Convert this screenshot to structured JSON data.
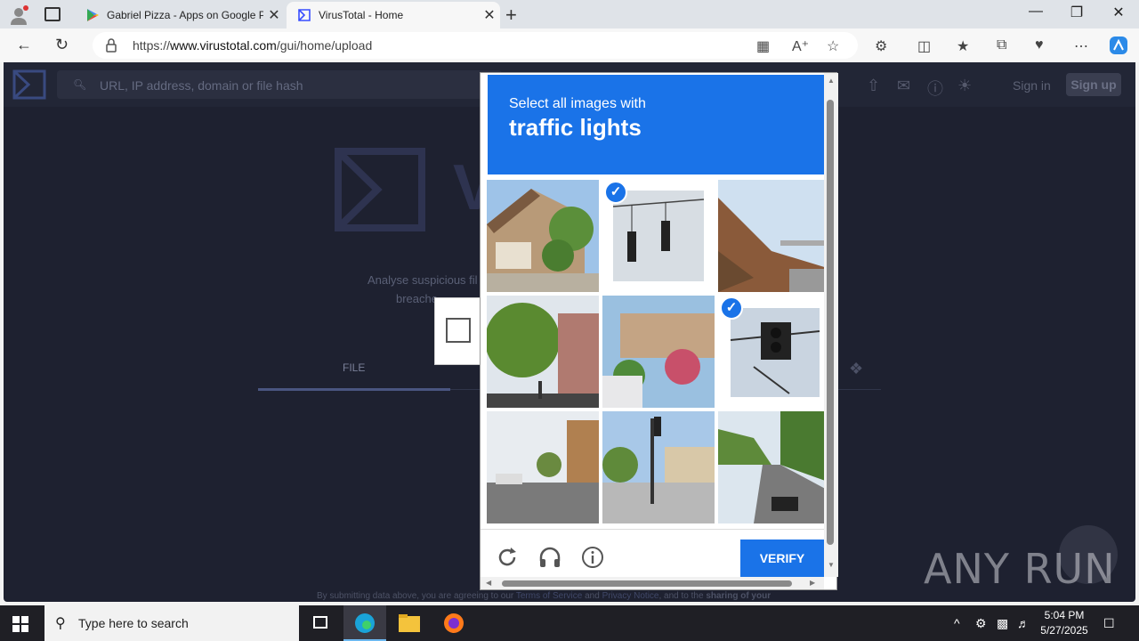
{
  "browser": {
    "tabs": [
      {
        "title": "Gabriel Pizza - Apps on Google Play",
        "active": false
      },
      {
        "title": "VirusTotal - Home",
        "active": true
      }
    ],
    "url_prefix": "https://",
    "url_host": "www.virustotal.com",
    "url_path": "/gui/home/upload",
    "new_tab_glyph": "+",
    "close_glyph": "✕"
  },
  "virustotal": {
    "search_placeholder": "URL, IP address, domain or file hash",
    "sign_in": "Sign in",
    "sign_up": "Sign up",
    "analyse_text": "Analyse suspicious fil",
    "breach_text": "breache",
    "tab_file": "FILE",
    "footer_prefix": "By submitting data above, you are agreeing to our ",
    "footer_tos": "Terms of Service",
    "footer_and": " and ",
    "footer_privacy": "Privacy Notice",
    "footer_suffix": ", and to the ",
    "footer_bold": "sharing of your"
  },
  "captcha": {
    "instruction_line1": "Select all images with",
    "instruction_line2": "traffic lights",
    "verify_label": "VERIFY",
    "tiles": [
      {
        "id": 1,
        "subject": "house-with-porch",
        "selected": false
      },
      {
        "id": 2,
        "subject": "traffic-lights-hanging",
        "selected": true
      },
      {
        "id": 3,
        "subject": "hillside-bridge",
        "selected": false
      },
      {
        "id": 4,
        "subject": "trees-street",
        "selected": false
      },
      {
        "id": 5,
        "subject": "house-garden-car",
        "selected": false
      },
      {
        "id": 6,
        "subject": "traffic-light-closeup",
        "selected": true
      },
      {
        "id": 7,
        "subject": "town-street",
        "selected": false
      },
      {
        "id": 8,
        "subject": "traffic-light-pole-street",
        "selected": false
      },
      {
        "id": 9,
        "subject": "highway-with-car",
        "selected": false
      }
    ],
    "colors": {
      "accent": "#1a73e8"
    }
  },
  "watermark": "ANY RUN",
  "taskbar": {
    "search_placeholder": "Type here to search",
    "time": "5:04 PM",
    "date": "5/27/2025"
  }
}
